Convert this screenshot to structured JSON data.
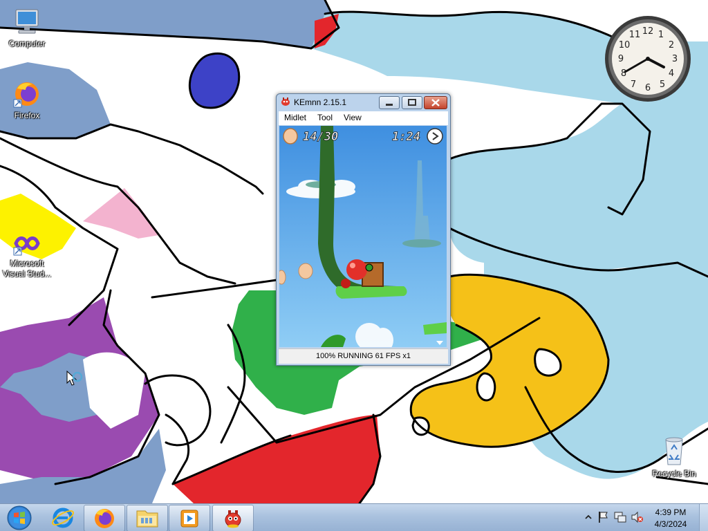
{
  "desktop": {
    "icons": [
      {
        "label": "Computer",
        "icon": "computer-icon"
      },
      {
        "label": "Firefox",
        "icon": "firefox-icon"
      },
      {
        "label": "Microsoft Visual Stud...",
        "label_line1": "Microsoft",
        "label_line2": "Visual Stud...",
        "icon": "visual-studio-icon"
      },
      {
        "label": "Recycle Bin",
        "icon": "recycle-bin-icon"
      }
    ]
  },
  "emulator": {
    "title": "KEmnn 2.15.1",
    "menu": [
      "Midlet",
      "Tool",
      "View"
    ],
    "status": "100% RUNNING 61 FPS x1",
    "game": {
      "eggs_collected": "14/30",
      "timer": "1:24"
    }
  },
  "taskbar": {
    "buttons": [
      {
        "name": "internet-explorer",
        "icon": "internet-explorer-icon",
        "state": "pinned"
      },
      {
        "name": "firefox",
        "icon": "firefox-icon",
        "state": "open"
      },
      {
        "name": "file-explorer",
        "icon": "folder-icon",
        "state": "open"
      },
      {
        "name": "media-player",
        "icon": "media-player-icon",
        "state": "open"
      },
      {
        "name": "kemulator",
        "icon": "kemulator-icon",
        "state": "active"
      }
    ],
    "tray": {
      "time": "4:39 PM",
      "date": "4/3/2024",
      "icons": [
        "show-hidden-icons-icon",
        "action-center-flag-icon",
        "network-icon",
        "volume-muted-icon"
      ]
    }
  },
  "colors": {
    "wallpaper_blue": "#7f9ec9",
    "wallpaper_light_blue": "#a9d8ea",
    "wallpaper_yellow": "#f5c118",
    "wallpaper_green": "#30b04a",
    "wallpaper_red": "#e3262c",
    "wallpaper_purple": "#9a4bb0",
    "game_sky": "#5aa6e6"
  }
}
